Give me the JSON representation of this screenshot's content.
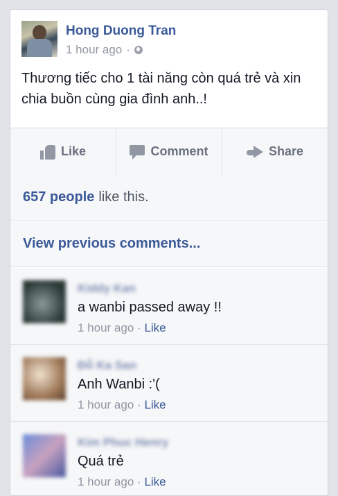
{
  "post": {
    "author": "Hong Duong Tran",
    "time": "1 hour ago",
    "separator": "·",
    "text": "Thương tiếc cho 1 tài năng còn quá trẻ và xin chia buồn cùng gia đình anh..!"
  },
  "actions": {
    "like": "Like",
    "comment": "Comment",
    "share": "Share"
  },
  "likes": {
    "count": "657 people",
    "suffix": "like this."
  },
  "view_previous": "View previous comments...",
  "comments": [
    {
      "name": "Kiddy Kan",
      "text": "a wanbi passed away !!",
      "time": "1 hour ago",
      "separator": "·",
      "like": "Like",
      "avatar_color_a": "#2b3a36",
      "avatar_color_b": "#8a9a98"
    },
    {
      "name": "Đỗ Ka San",
      "text": "Anh Wanbi :'(",
      "time": "1 hour ago",
      "separator": "·",
      "like": "Like",
      "avatar_color_a": "#d8c4b0",
      "avatar_color_b": "#7a5a42"
    },
    {
      "name": "Kim Phuc Henry",
      "text": "Quá trẻ",
      "time": "1 hour ago",
      "separator": "·",
      "like": "Like",
      "avatar_color_a": "#6a8cd8",
      "avatar_color_b": "#c8a2c0"
    }
  ],
  "colors": {
    "brand": "#3b5998",
    "muted": "#9197a3",
    "background": "#e1e3e8"
  }
}
